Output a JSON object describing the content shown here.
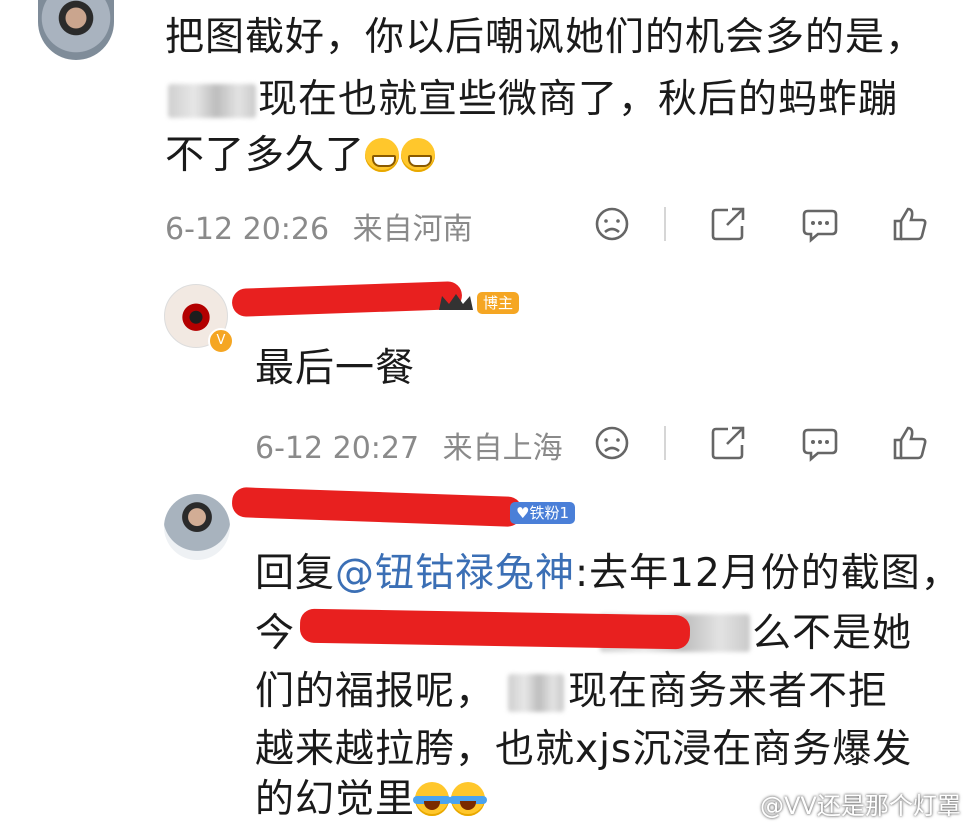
{
  "comment1": {
    "lines": [
      "把图截好，你以后嘲讽她们的机会多的是，",
      "现在也就宣些微商了，秋后的蚂蚱蹦",
      "不了多久了"
    ],
    "timestamp": "6-12 20:26",
    "location": "来自河南"
  },
  "reply1": {
    "badge": "博主",
    "text": "最后一餐",
    "timestamp": "6-12 20:27",
    "location": "来自上海"
  },
  "reply2": {
    "badge": "铁粉1",
    "line1_prefix": "回复",
    "mention": "@钮钴禄兔神",
    "line1_suffix": ":去年12月份的截图，",
    "line2_start": "今",
    "line2_end": "么不是她",
    "line3_start": "们的福报呢，",
    "line3_end": "现在商务来者不拒",
    "line4": "越来越拉胯，也就xjs沉浸在商务爆发",
    "line5": "的幻觉里"
  },
  "watermark": "@VV还是那个灯罩",
  "icons": [
    "dislike-icon",
    "share-icon",
    "comment-icon",
    "like-icon",
    "weibo-logo-icon",
    "verified-badge-icon"
  ],
  "colors": {
    "meta_text": "#8a8a8a",
    "mention": "#3b6fb5",
    "redact": "#e8201f",
    "blogger_badge": "#f5a623",
    "fan_badge": "#4a7fd8"
  }
}
